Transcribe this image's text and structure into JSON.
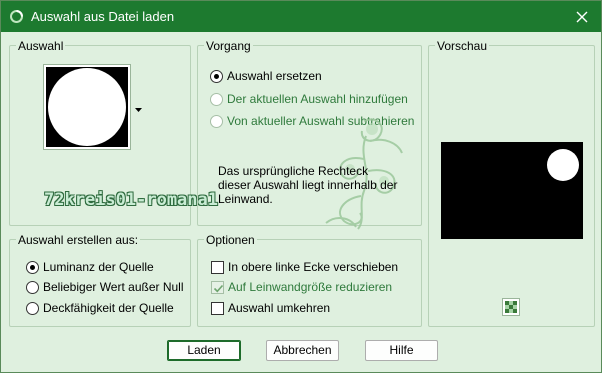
{
  "window": {
    "title": "Auswahl aus Datei laden",
    "close_icon": "close-icon",
    "app_icon": "app-icon"
  },
  "auswahl": {
    "title": "Auswahl",
    "dropdown_icon": "dropdown-arrow-icon"
  },
  "watermark": {
    "text": "72kreis01-romana1"
  },
  "vorgang": {
    "title": "Vorgang",
    "options": [
      {
        "label": "Auswahl ersetzen",
        "checked": true,
        "enabled": true
      },
      {
        "label": "Der aktuellen Auswahl hinzufügen",
        "checked": false,
        "enabled": false
      },
      {
        "label": "Von aktueller Auswahl subtrahieren",
        "checked": false,
        "enabled": false
      }
    ],
    "note": "Das ursprüngliche Rechteck dieser Auswahl liegt innerhalb der Leinwand."
  },
  "vorschau": {
    "title": "Vorschau",
    "toggle_icon": "checkerboard-icon"
  },
  "erstellen": {
    "title": "Auswahl erstellen aus:",
    "options": [
      {
        "label": "Luminanz der Quelle",
        "checked": true
      },
      {
        "label": "Beliebiger Wert außer Null",
        "checked": false
      },
      {
        "label": "Deckfähigkeit der Quelle",
        "checked": false
      }
    ]
  },
  "optionen": {
    "title": "Optionen",
    "items": [
      {
        "label": "In obere linke Ecke verschieben",
        "checked": false,
        "enabled": true
      },
      {
        "label": "Auf Leinwandgröße reduzieren",
        "checked": true,
        "enabled": false
      },
      {
        "label": "Auswahl umkehren",
        "checked": false,
        "enabled": true
      }
    ]
  },
  "buttons": {
    "ok": "Laden",
    "cancel": "Abbrechen",
    "help": "Hilfe"
  },
  "colors": {
    "titlebar": "#1d7a2f",
    "dialog_bg": "#dff0df",
    "accent_disabled": "#2f7a3c"
  }
}
